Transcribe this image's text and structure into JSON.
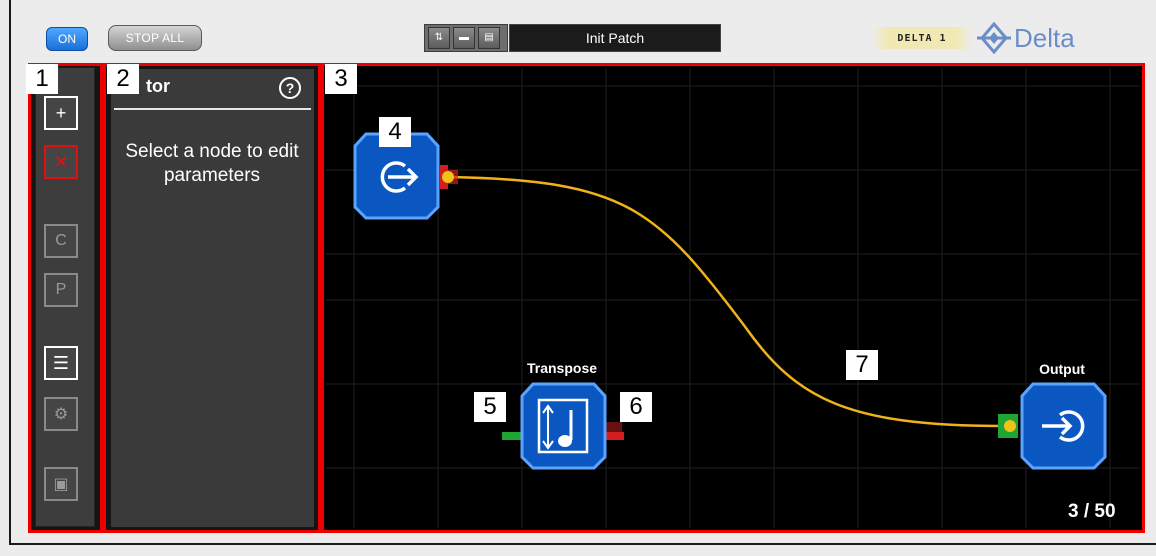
{
  "header": {
    "on_label": "ON",
    "stop_all_label": "STOP ALL",
    "patch_name": "Init Patch",
    "badge_text": "DELTA 1",
    "logo_text": "Delta"
  },
  "toolbar": {
    "tools": [
      {
        "name": "add-node",
        "glyph": "+"
      },
      {
        "name": "delete-node",
        "glyph": "✕"
      },
      {
        "name": "copy",
        "glyph": "C"
      },
      {
        "name": "paste",
        "glyph": "P"
      },
      {
        "name": "list",
        "glyph": "☰"
      },
      {
        "name": "settings",
        "glyph": "⚙"
      },
      {
        "name": "window",
        "glyph": "▣"
      }
    ]
  },
  "editor": {
    "title": "tor",
    "help_glyph": "?",
    "message": "Select a node to edit parameters"
  },
  "canvas": {
    "nodes": [
      {
        "id": "input",
        "label": ""
      },
      {
        "id": "transpose",
        "label": "Transpose"
      },
      {
        "id": "output",
        "label": "Output"
      }
    ],
    "page_count": "3 / 50"
  },
  "callouts": [
    "1",
    "2",
    "3",
    "4",
    "5",
    "6",
    "7"
  ],
  "colors": {
    "accent_blue": "#0a57c2",
    "node_border": "#5aa4ff",
    "panel_outline": "#ee0000",
    "wire": "#f0b21a",
    "port_green": "#1ea532",
    "port_red": "#d21e1e"
  }
}
